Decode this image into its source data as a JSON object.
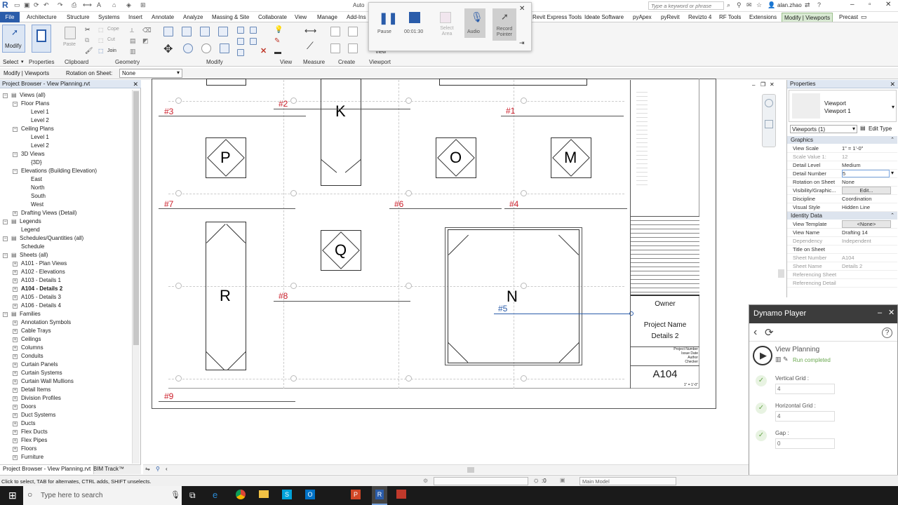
{
  "app": {
    "title_center": "Auto",
    "search_placeholder": "Type a keyword or phrase",
    "user": "alan.zhao"
  },
  "tabs": [
    "File",
    "Architecture",
    "Structure",
    "Systems",
    "Insert",
    "Annotate",
    "Analyze",
    "Massing & Site",
    "Collaborate",
    "View",
    "Manage",
    "Add-Ins",
    "Revit Express Tools",
    "Ideate Software",
    "pyApex",
    "pyRevit",
    "Revizto 4",
    "RF Tools",
    "Extensions",
    "Modify | Viewports",
    "Precast"
  ],
  "ribbon": {
    "modify_label": "Modify",
    "select_label": "Select",
    "properties_label": "Properties",
    "clipboard_label": "Clipboard",
    "paste_label": "Paste",
    "cope_label": "Cope",
    "cut_label": "Cut",
    "join_label": "Join",
    "geometry_label": "Geometry",
    "modify_group_label": "Modify",
    "view_label": "View",
    "measure_label": "Measure",
    "create_label": "Create",
    "viewport_label": "Viewport",
    "view_small": "View"
  },
  "optionbar": {
    "context": "Modify | Viewports",
    "rotation_label": "Rotation on Sheet:",
    "rotation_value": "None"
  },
  "recorder": {
    "pause": "Pause",
    "time": "00:01:30",
    "select_area": "Select Area",
    "audio": "Audio",
    "record_pointer": "Record Pointer"
  },
  "project_browser": {
    "title": "Project Browser - View Planning.rvt",
    "items": [
      {
        "label": "Views (all)",
        "indent": 0
      },
      {
        "label": "Floor Plans",
        "indent": 1
      },
      {
        "label": "Level 1",
        "indent": 2
      },
      {
        "label": "Level 2",
        "indent": 2
      },
      {
        "label": "Ceiling Plans",
        "indent": 1
      },
      {
        "label": "Level 1",
        "indent": 2
      },
      {
        "label": "Level 2",
        "indent": 2
      },
      {
        "label": "3D Views",
        "indent": 1
      },
      {
        "label": "{3D}",
        "indent": 2
      },
      {
        "label": "Elevations (Building Elevation)",
        "indent": 1
      },
      {
        "label": "East",
        "indent": 2
      },
      {
        "label": "North",
        "indent": 2
      },
      {
        "label": "South",
        "indent": 2
      },
      {
        "label": "West",
        "indent": 2
      },
      {
        "label": "Drafting Views (Detail)",
        "indent": 1
      },
      {
        "label": "Legends",
        "indent": 0
      },
      {
        "label": "Legend",
        "indent": 1
      },
      {
        "label": "Schedules/Quantities (all)",
        "indent": 0
      },
      {
        "label": "Schedule",
        "indent": 1
      },
      {
        "label": "Sheets (all)",
        "indent": 0
      },
      {
        "label": "A101 - Plan Views",
        "indent": 1
      },
      {
        "label": "A102 - Elevations",
        "indent": 1
      },
      {
        "label": "A103 - Details 1",
        "indent": 1
      },
      {
        "label": "A104 - Details 2",
        "indent": 1,
        "bold": true
      },
      {
        "label": "A105 - Details 3",
        "indent": 1
      },
      {
        "label": "A106 - Details 4",
        "indent": 1
      },
      {
        "label": "Families",
        "indent": 0
      },
      {
        "label": "Annotation Symbols",
        "indent": 1
      },
      {
        "label": "Cable Trays",
        "indent": 1
      },
      {
        "label": "Ceilings",
        "indent": 1
      },
      {
        "label": "Columns",
        "indent": 1
      },
      {
        "label": "Conduits",
        "indent": 1
      },
      {
        "label": "Curtain Panels",
        "indent": 1
      },
      {
        "label": "Curtain Systems",
        "indent": 1
      },
      {
        "label": "Curtain Wall Mullions",
        "indent": 1
      },
      {
        "label": "Detail Items",
        "indent": 1
      },
      {
        "label": "Division Profiles",
        "indent": 1
      },
      {
        "label": "Doors",
        "indent": 1
      },
      {
        "label": "Duct Systems",
        "indent": 1
      },
      {
        "label": "Ducts",
        "indent": 1
      },
      {
        "label": "Flex Ducts",
        "indent": 1
      },
      {
        "label": "Flex Pipes",
        "indent": 1
      },
      {
        "label": "Floors",
        "indent": 1
      },
      {
        "label": "Furniture",
        "indent": 1
      }
    ],
    "bottom_tabs": [
      "Project Browser - View Planning.rvt",
      "BIM Track™"
    ]
  },
  "sheet": {
    "labels_red": [
      "#3",
      "#2",
      "#1",
      "#7",
      "#6",
      "#4",
      "#8",
      "#9"
    ],
    "label_blue": "#5",
    "letters": [
      "K",
      "P",
      "O",
      "M",
      "Q",
      "R",
      "N"
    ],
    "titleblock": {
      "owner": "Owner",
      "project_name": "Project Name",
      "sheet_name": "Details 2",
      "sheet_number": "A104",
      "rows": [
        "Project Number",
        "Issue Date",
        "Author",
        "Checker"
      ],
      "scale": "1\" = 1'-0\""
    }
  },
  "properties": {
    "title": "Properties",
    "type_family": "Viewport",
    "type_name": "Viewport 1",
    "selector": "Viewports (1)",
    "edit_type": "Edit Type",
    "sections": [
      {
        "name": "Graphics",
        "rows": [
          {
            "k": "View Scale",
            "v": "1\" = 1'-0\""
          },
          {
            "k": "Scale Value    1:",
            "v": "12",
            "dim": true
          },
          {
            "k": "Detail Level",
            "v": "Medium"
          },
          {
            "k": "Detail Number",
            "v": "5"
          },
          {
            "k": "Rotation on Sheet",
            "v": "None"
          },
          {
            "k": "Visibility/Graphic...",
            "v": "Edit..."
          },
          {
            "k": "Discipline",
            "v": "Coordination"
          },
          {
            "k": "Visual Style",
            "v": "Hidden Line"
          }
        ]
      },
      {
        "name": "Identity Data",
        "rows": [
          {
            "k": "View Template",
            "v": "<None>"
          },
          {
            "k": "View Name",
            "v": "Drafting 14"
          },
          {
            "k": "Dependency",
            "v": "Independent",
            "dim": true
          },
          {
            "k": "Title on Sheet",
            "v": ""
          },
          {
            "k": "Sheet Number",
            "v": "A104",
            "dim": true
          },
          {
            "k": "Sheet Name",
            "v": "Details 2",
            "dim": true
          },
          {
            "k": "Referencing Sheet",
            "v": "",
            "dim": true
          },
          {
            "k": "Referencing Detail",
            "v": "",
            "dim": true
          }
        ]
      }
    ]
  },
  "dynamo": {
    "title": "Dynamo Player",
    "script_name": "View Planning",
    "status": "Run completed",
    "inputs": [
      {
        "label": "Vertical Grid :",
        "value": "4"
      },
      {
        "label": "Horizontal Grid :",
        "value": "4"
      },
      {
        "label": "Gap :",
        "value": "0"
      }
    ]
  },
  "status": {
    "hint": "Click to select, TAB for alternates, CTRL adds, SHIFT unselects.",
    "zero": ":0",
    "model": "Main Model"
  },
  "taskbar": {
    "search_placeholder": "Type here to search"
  }
}
